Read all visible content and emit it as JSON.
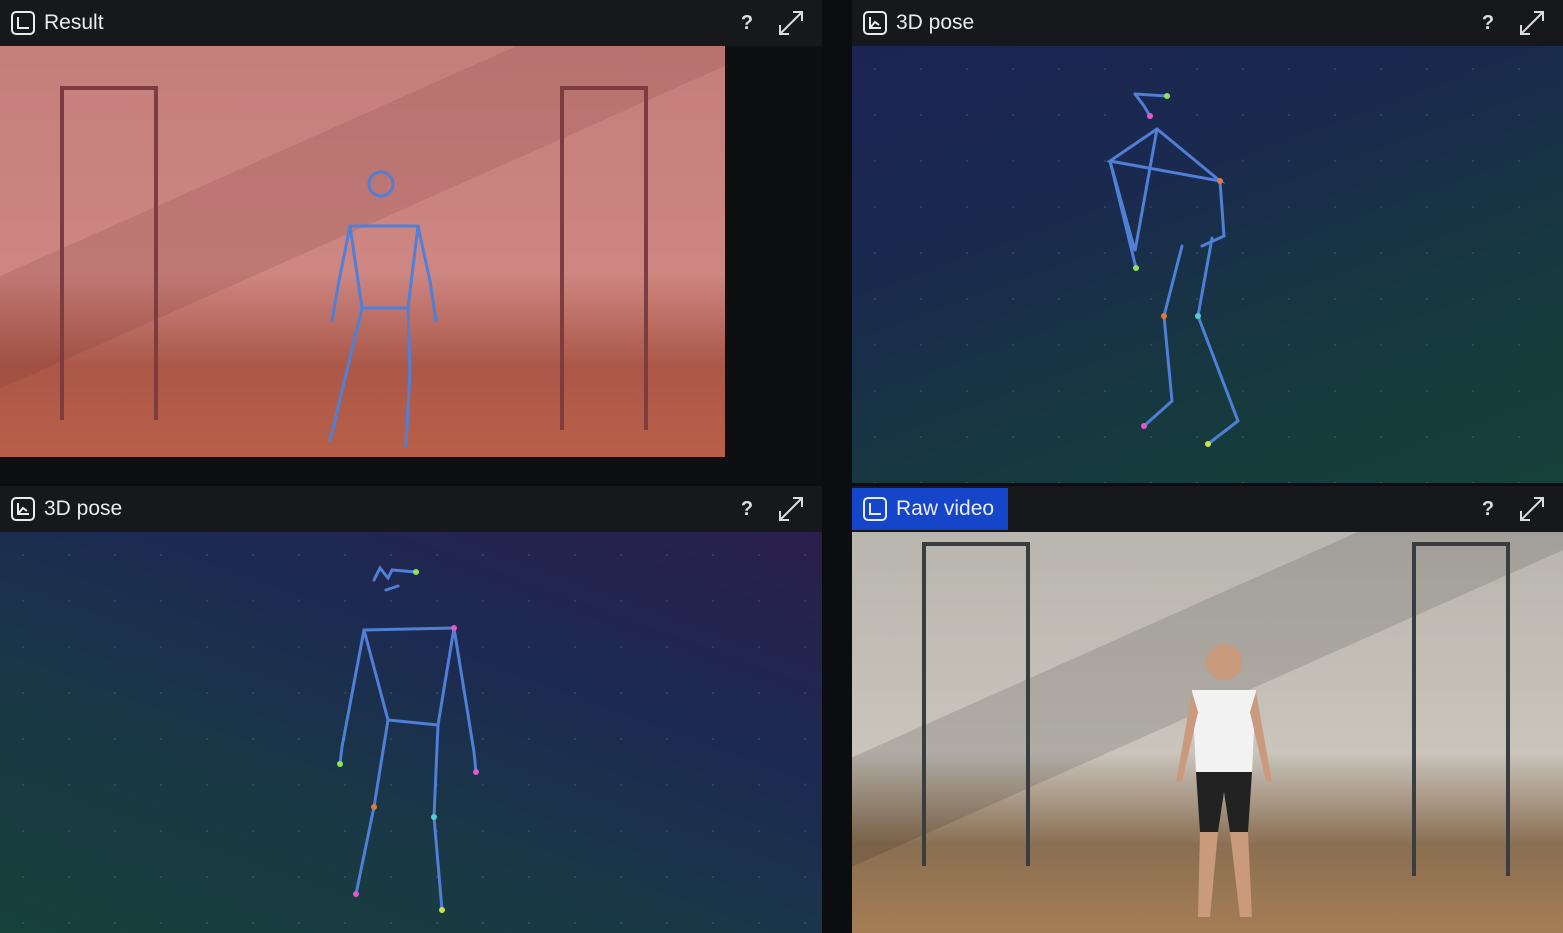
{
  "panels": {
    "result": {
      "title": "Result",
      "help": "?"
    },
    "pose_top": {
      "title": "3D pose",
      "help": "?"
    },
    "pose_bottom": {
      "title": "3D pose",
      "help": "?"
    },
    "raw_video": {
      "title": "Raw video",
      "help": "?"
    }
  },
  "icons": {
    "view": "chart-view-icon",
    "help": "help-icon",
    "expand": "expand-icon"
  },
  "colors": {
    "active_tab": "#1546c9",
    "skeleton": "#4f7fd6",
    "header_bg": "#16181b"
  }
}
